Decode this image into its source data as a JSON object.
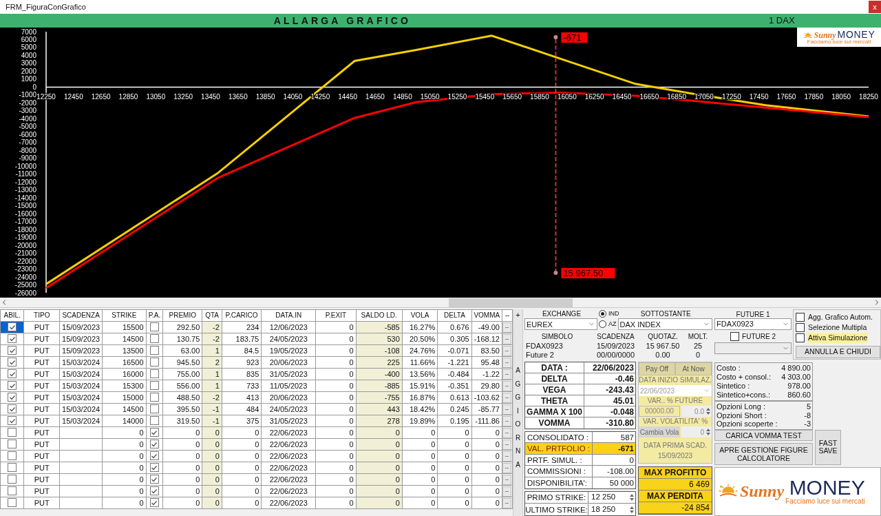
{
  "window": {
    "title": "FRM_FiguraConGrafico",
    "close": "x"
  },
  "header": {
    "button": "ALLARGA GRAFICO",
    "instrument": "1 DAX"
  },
  "chart": {
    "chart_data": {
      "type": "line",
      "x": [
        12250,
        13500,
        14500,
        14950,
        15500,
        16000,
        16550,
        16950,
        17500,
        18250
      ],
      "series": [
        {
          "color": "#f5d000",
          "values": [
            -24900,
            -10900,
            3300,
            4700,
            6500,
            3600,
            400,
            -800,
            -2300,
            -3700
          ]
        },
        {
          "color": "#ff0000",
          "values": [
            -25400,
            -11500,
            -3900,
            -1900,
            -900,
            -700,
            -1100,
            -1700,
            -2600,
            -3800
          ]
        }
      ],
      "xlim": [
        12250,
        18250
      ],
      "ylim": [
        -26000,
        7000
      ],
      "xticks": [
        12250,
        12450,
        12650,
        12850,
        13050,
        13250,
        13450,
        13650,
        13850,
        14050,
        14250,
        14450,
        14650,
        14850,
        15050,
        15250,
        15450,
        15650,
        15850,
        16050,
        16250,
        16450,
        16650,
        16850,
        17050,
        17250,
        17450,
        17650,
        17850,
        18050,
        18250
      ],
      "yticks": [
        7000,
        6000,
        5000,
        4000,
        3000,
        2000,
        1000,
        0,
        -1000,
        -2000,
        -3000,
        -4000,
        -5000,
        -6000,
        -7000,
        -8000,
        -9000,
        -10000,
        -11000,
        -12000,
        -13000,
        -14000,
        -15000,
        -16000,
        -17000,
        -18000,
        -19000,
        -20000,
        -21000,
        -22000,
        -23000,
        -24000,
        -25000,
        -26000
      ],
      "ref_lines": [
        {
          "axis": "x",
          "value": 15967.5
        }
      ],
      "annotations": [
        "-671",
        "15 967.50"
      ]
    },
    "logo": {
      "brand": "Sunny",
      "name": "MONEY",
      "tagline": "Facciamo luce sui mercati"
    }
  },
  "positions": {
    "columns": [
      "ABIL.",
      "TIPO",
      "SCADENZA",
      "STRIKE",
      "P.A.",
      "PREMIO",
      "QTA",
      "P.CARICO",
      "DATA.IN",
      "P.EXIT",
      "SALDO LD.",
      "VOLA",
      "DELTA",
      "VOMMA",
      "--"
    ],
    "rows": [
      {
        "selected": true,
        "enabled": true,
        "type": "PUT",
        "expiry": "15/09/2023",
        "strike": "15500",
        "pa": false,
        "premium": "292.50",
        "qty": "-2",
        "load_price": "234",
        "date_in": "12/06/2023",
        "exit": "0",
        "balance": "-585",
        "vol": "16.27%",
        "delta": "0.676",
        "vomma": "-49.00",
        "action": "--"
      },
      {
        "selected": false,
        "enabled": true,
        "type": "PUT",
        "expiry": "15/09/2023",
        "strike": "14500",
        "pa": false,
        "premium": "130.75",
        "qty": "-2",
        "load_price": "183.75",
        "date_in": "24/05/2023",
        "exit": "0",
        "balance": "530",
        "vol": "20.50%",
        "delta": "0.305",
        "vomma": "-168.12",
        "action": "--"
      },
      {
        "selected": false,
        "enabled": true,
        "type": "PUT",
        "expiry": "15/09/2023",
        "strike": "13500",
        "pa": false,
        "premium": "63.00",
        "qty": "1",
        "load_price": "84.5",
        "date_in": "19/05/2023",
        "exit": "0",
        "balance": "-108",
        "vol": "24.76%",
        "delta": "-0.071",
        "vomma": "83.50",
        "action": "--"
      },
      {
        "selected": false,
        "enabled": true,
        "type": "PUT",
        "expiry": "15/03/2024",
        "strike": "16500",
        "pa": false,
        "premium": "945.50",
        "qty": "2",
        "load_price": "923",
        "date_in": "20/06/2023",
        "exit": "0",
        "balance": "225",
        "vol": "11.66%",
        "delta": "-1.221",
        "vomma": "95.48",
        "action": "--"
      },
      {
        "selected": false,
        "enabled": true,
        "type": "PUT",
        "expiry": "15/03/2024",
        "strike": "16000",
        "pa": false,
        "premium": "755.00",
        "qty": "1",
        "load_price": "835",
        "date_in": "31/05/2023",
        "exit": "0",
        "balance": "-400",
        "vol": "13.56%",
        "delta": "-0.484",
        "vomma": "-1.22",
        "action": "--"
      },
      {
        "selected": false,
        "enabled": true,
        "type": "PUT",
        "expiry": "15/03/2024",
        "strike": "15300",
        "pa": false,
        "premium": "556.00",
        "qty": "1",
        "load_price": "733",
        "date_in": "11/05/2023",
        "exit": "0",
        "balance": "-885",
        "vol": "15.91%",
        "delta": "-0.351",
        "vomma": "29.80",
        "action": "--"
      },
      {
        "selected": false,
        "enabled": true,
        "type": "PUT",
        "expiry": "15/03/2024",
        "strike": "15000",
        "pa": false,
        "premium": "488.50",
        "qty": "-2",
        "load_price": "413",
        "date_in": "20/06/2023",
        "exit": "0",
        "balance": "-755",
        "vol": "16.87%",
        "delta": "0.613",
        "vomma": "-103.62",
        "action": "--"
      },
      {
        "selected": false,
        "enabled": true,
        "type": "PUT",
        "expiry": "15/03/2024",
        "strike": "14500",
        "pa": false,
        "premium": "395.50",
        "qty": "-1",
        "load_price": "484",
        "date_in": "24/05/2023",
        "exit": "0",
        "balance": "443",
        "vol": "18.42%",
        "delta": "0.245",
        "vomma": "-85.77",
        "action": "--"
      },
      {
        "selected": false,
        "enabled": true,
        "type": "PUT",
        "expiry": "15/03/2024",
        "strike": "14000",
        "pa": false,
        "premium": "319.50",
        "qty": "-1",
        "load_price": "375",
        "date_in": "31/05/2023",
        "exit": "0",
        "balance": "278",
        "vol": "19.89%",
        "delta": "0.195",
        "vomma": "-111.86",
        "action": "--"
      },
      {
        "selected": false,
        "enabled": false,
        "type": "PUT",
        "strike": "0",
        "pa": true,
        "premium": "0",
        "qty": "0",
        "load_price": "0",
        "date_in": "22/06/2023",
        "exit": "0",
        "balance": "0",
        "vol": "0",
        "delta": "0",
        "vomma": "0",
        "action": "--"
      },
      {
        "selected": false,
        "enabled": false,
        "type": "PUT",
        "strike": "0",
        "pa": true,
        "premium": "0",
        "qty": "0",
        "load_price": "0",
        "date_in": "22/06/2023",
        "exit": "0",
        "balance": "0",
        "vol": "0",
        "delta": "0",
        "vomma": "0",
        "action": "--"
      },
      {
        "selected": false,
        "enabled": false,
        "type": "PUT",
        "strike": "0",
        "pa": true,
        "premium": "0",
        "qty": "0",
        "load_price": "0",
        "date_in": "22/06/2023",
        "exit": "0",
        "balance": "0",
        "vol": "0",
        "delta": "0",
        "vomma": "0",
        "action": "--"
      },
      {
        "selected": false,
        "enabled": false,
        "type": "PUT",
        "strike": "0",
        "pa": true,
        "premium": "0",
        "qty": "0",
        "load_price": "0",
        "date_in": "22/06/2023",
        "exit": "0",
        "balance": "0",
        "vol": "0",
        "delta": "0",
        "vomma": "0",
        "action": "--"
      },
      {
        "selected": false,
        "enabled": false,
        "type": "PUT",
        "strike": "0",
        "pa": true,
        "premium": "0",
        "qty": "0",
        "load_price": "0",
        "date_in": "22/06/2023",
        "exit": "0",
        "balance": "0",
        "vol": "0",
        "delta": "0",
        "vomma": "0",
        "action": "--"
      },
      {
        "selected": false,
        "enabled": false,
        "type": "PUT",
        "strike": "0",
        "pa": true,
        "premium": "0",
        "qty": "0",
        "load_price": "0",
        "date_in": "22/06/2023",
        "exit": "0",
        "balance": "0",
        "vol": "0",
        "delta": "0",
        "vomma": "0",
        "action": "--"
      },
      {
        "selected": false,
        "enabled": false,
        "type": "PUT",
        "strike": "0",
        "pa": true,
        "premium": "0",
        "qty": "0",
        "load_price": "0",
        "date_in": "22/06/2023",
        "exit": "0",
        "balance": "0",
        "vol": "0",
        "delta": "0",
        "vomma": "0",
        "action": "--"
      }
    ]
  },
  "side_strip": {
    "add": "+",
    "label": "AGGIORNA"
  },
  "market": {
    "exchange_label": "EXCHANGE",
    "exchange": "EUREX",
    "radios": [
      {
        "label": "IND",
        "selected": true
      },
      {
        "label": "AZ",
        "selected": false
      }
    ],
    "underlying_label": "SOTTOSTANTE",
    "underlying": "DAX INDEX",
    "columns": [
      "SIMBOLO",
      "SCADENZA",
      "QUOTAZ.",
      "MOLT."
    ],
    "rows": [
      [
        "FDAX0923",
        "15/09/2023",
        "15 967.50",
        "25"
      ],
      [
        "Future 2",
        "00/00/0000",
        "0.00",
        "0"
      ]
    ]
  },
  "futures": {
    "future1_label": "FUTURE 1",
    "future1": "FDAX0923",
    "future2": {
      "label": "FUTURE 2",
      "checked": false
    }
  },
  "options": [
    {
      "label": "Agg. Grafico Autom.",
      "checked": false,
      "highlight": false
    },
    {
      "label": "Selezione Multipla",
      "checked": false,
      "highlight": false
    },
    {
      "label": "Attiva Simulazione",
      "checked": false,
      "highlight": true
    }
  ],
  "greeks": [
    {
      "label": "DATA :",
      "value": "22/06/2023"
    },
    {
      "label": "DELTA",
      "value": "-0.46"
    },
    {
      "label": "VEGA",
      "value": "-243.43"
    },
    {
      "label": "THETA",
      "value": "45.01"
    },
    {
      "label": "GAMMA X 100",
      "value": "-0.048"
    },
    {
      "label": "VOMMA",
      "value": "-310.80"
    }
  ],
  "portfolio": [
    {
      "label": "CONSOLIDATO :",
      "value": "587",
      "highlight": false
    },
    {
      "label": "VAL. PRTFOLIO :",
      "value": "-671",
      "highlight": true
    },
    {
      "label": "PRTF. SIMUL. :",
      "value": "0",
      "highlight": false
    },
    {
      "label": "COMMISSIONI :",
      "value": "-108.00",
      "highlight": false
    },
    {
      "label": "DISPONIBILITA':",
      "value": "50 000",
      "highlight": false
    }
  ],
  "strikes": [
    {
      "label": "PRIMO STRIKE:",
      "value": "12 250"
    },
    {
      "label": "ULTIMO STRIKE:",
      "value": "18 250"
    }
  ],
  "simulation": {
    "tabs": [
      "Pay Off",
      "At Now"
    ],
    "start_label": "DATA INIZIO SIMULAZ.",
    "start_date": "22/06/2023",
    "future_var_label": "VAR.. % FUTURE",
    "future_price": "00000.00",
    "future_pct": "0.0",
    "vol_var_label": "VAR. VOLATILITA' %",
    "vol_button": "Cambia Vola",
    "vol_pct": "0",
    "first_expiry_label": "DATA PRIMA SCAD.",
    "first_expiry": "15/09/2023"
  },
  "extremes": [
    {
      "label": "MAX PROFITTO",
      "value": "6 469"
    },
    {
      "label": "MAX PERDITA",
      "value": "-24 854"
    }
  ],
  "costs": [
    {
      "label": "Costo :",
      "value": "4 890.00"
    },
    {
      "label": "Costo + consol.:",
      "value": "4 303.00"
    },
    {
      "label": "Sintetico :",
      "value": "978.00"
    },
    {
      "label": "Sintetico+cons.:",
      "value": "860.60"
    }
  ],
  "option_counts": [
    {
      "label": "Opzioni Long :",
      "value": "5"
    },
    {
      "label": "Opzioni Short :",
      "value": "-8"
    },
    {
      "label": "Opzioni scoperte :",
      "value": "-3"
    }
  ],
  "buttons": {
    "close": "ANNULLA E CHIUDI",
    "vomma": "CARICA VOMMA TEST",
    "figures": "APRE GESTIONE FIGURE CALCOLATORE",
    "fast_save": "FAST SAVE"
  },
  "logo": {
    "brand": "Sunny",
    "name": "MONEY",
    "tagline": "Facciamo luce sui mercati"
  }
}
